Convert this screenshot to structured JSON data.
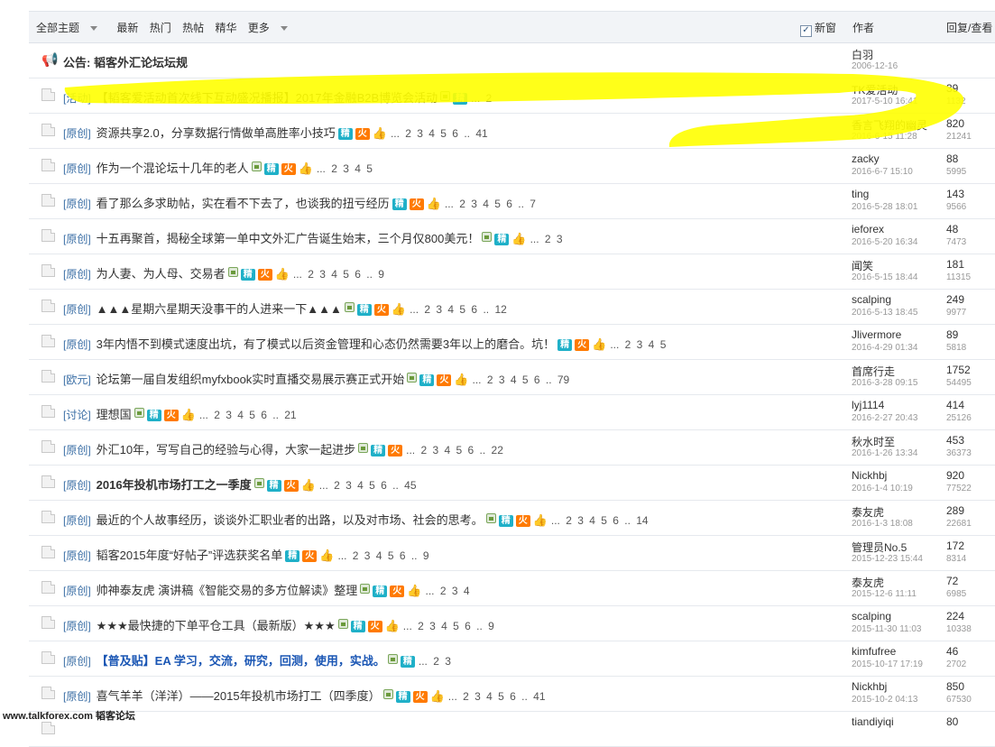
{
  "header": {
    "filters": [
      "全部主题",
      "最新",
      "热门",
      "热帖",
      "精华",
      "更多"
    ],
    "new_window_label": "新窗",
    "author_col": "作者",
    "reply_col": "回复/查看"
  },
  "announcement": {
    "label": "公告:",
    "title": "韬客外汇论坛坛规",
    "author": "白羽",
    "date": "2006-12-16"
  },
  "badges": {
    "jing": "精",
    "huo": "火",
    "thumb": "👍"
  },
  "threads": [
    {
      "cat": "[活动]",
      "title": "【韬客爱活动首次线下互动盛况播报】2017年金融B2B博览会活动",
      "img": true,
      "jing": true,
      "huo": false,
      "thumb": false,
      "pages": "... 2",
      "author": "TK爱活动",
      "date": "2017-5-10 16:41",
      "replies": "39",
      "views": "1132",
      "style": ""
    },
    {
      "cat": "[原创]",
      "title": "资源共享2.0，分享数据行情做单高胜率小技巧",
      "img": false,
      "jing": true,
      "huo": true,
      "thumb": true,
      "pages": "... 2 3 4 5 6 .. 41",
      "author": "香言飞翔的幽灵",
      "date": "2016-6-15 11:28",
      "replies": "820",
      "views": "21241",
      "style": ""
    },
    {
      "cat": "[原创]",
      "title": "作为一个混论坛十几年的老人",
      "img": true,
      "jing": true,
      "huo": true,
      "thumb": true,
      "pages": "... 2 3 4 5",
      "author": "zacky",
      "date": "2016-6-7 15:10",
      "replies": "88",
      "views": "5995",
      "style": ""
    },
    {
      "cat": "[原创]",
      "title": "看了那么多求助帖，实在看不下去了，也谈我的扭亏经历",
      "img": false,
      "jing": true,
      "huo": true,
      "thumb": true,
      "pages": "... 2 3 4 5 6 .. 7",
      "author": "ting",
      "date": "2016-5-28 18:01",
      "replies": "143",
      "views": "9566",
      "style": ""
    },
    {
      "cat": "[原创]",
      "title": "十五再聚首，揭秘全球第一单中文外汇广告诞生始末，三个月仅800美元！",
      "img": true,
      "jing": true,
      "huo": false,
      "thumb": true,
      "pages": "... 2 3",
      "author": "ieforex",
      "date": "2016-5-20 16:34",
      "replies": "48",
      "views": "7473",
      "style": ""
    },
    {
      "cat": "[原创]",
      "title": "为人妻、为人母、交易者",
      "img": true,
      "jing": true,
      "huo": true,
      "thumb": true,
      "pages": "... 2 3 4 5 6 .. 9",
      "author": "闻笑",
      "date": "2016-5-15 18:44",
      "replies": "181",
      "views": "11315",
      "style": ""
    },
    {
      "cat": "[原创]",
      "title": "▲▲▲星期六星期天没事干的人进来一下▲▲▲",
      "img": true,
      "jing": true,
      "huo": true,
      "thumb": true,
      "pages": "... 2 3 4 5 6 .. 12",
      "author": "scalping",
      "date": "2016-5-13 18:45",
      "replies": "249",
      "views": "9977",
      "style": ""
    },
    {
      "cat": "[原创]",
      "title": "3年内悟不到模式速度出坑，有了模式以后资金管理和心态仍然需要3年以上的磨合。坑！",
      "img": false,
      "jing": true,
      "huo": true,
      "thumb": true,
      "pages": "... 2 3 4 5",
      "author": "Jlivermore",
      "date": "2016-4-29 01:34",
      "replies": "89",
      "views": "5818",
      "style": ""
    },
    {
      "cat": "[欧元]",
      "title": "论坛第一届自发组织myfxbook实时直播交易展示赛正式开始",
      "img": true,
      "jing": true,
      "huo": true,
      "thumb": true,
      "pages": "... 2 3 4 5 6 .. 79",
      "author": "首席行走",
      "date": "2016-3-28 09:15",
      "replies": "1752",
      "views": "54495",
      "style": ""
    },
    {
      "cat": "[讨论]",
      "title": "理想国",
      "img": true,
      "jing": true,
      "huo": true,
      "thumb": true,
      "pages": "... 2 3 4 5 6 .. 21",
      "author": "lyj1114",
      "date": "2016-2-27 20:43",
      "replies": "414",
      "views": "25126",
      "style": ""
    },
    {
      "cat": "[原创]",
      "title": "外汇10年，写写自己的经验与心得，大家一起进步",
      "img": true,
      "jing": true,
      "huo": true,
      "thumb": false,
      "pages": "... 2 3 4 5 6 .. 22",
      "author": "秋水时至",
      "date": "2016-1-26 13:34",
      "replies": "453",
      "views": "36373",
      "style": ""
    },
    {
      "cat": "[原创]",
      "title": "2016年投机市场打工之一季度",
      "img": true,
      "jing": true,
      "huo": true,
      "thumb": true,
      "pages": "... 2 3 4 5 6 .. 45",
      "author": "Nickhbj",
      "date": "2016-1-4 10:19",
      "replies": "920",
      "views": "77522",
      "style": "bold"
    },
    {
      "cat": "[原创]",
      "title": "最近的个人故事经历，谈谈外汇职业者的出路，以及对市场、社会的思考。",
      "img": true,
      "jing": true,
      "huo": true,
      "thumb": true,
      "pages": "... 2 3 4 5 6 .. 14",
      "author": "泰友虎",
      "date": "2016-1-3 18:08",
      "replies": "289",
      "views": "22681",
      "style": ""
    },
    {
      "cat": "[原创]",
      "title": "韬客2015年度“好帖子”评选获奖名单",
      "img": false,
      "jing": true,
      "huo": true,
      "thumb": true,
      "pages": "... 2 3 4 5 6 .. 9",
      "author": "管理员No.5",
      "date": "2015-12-23 15:44",
      "replies": "172",
      "views": "8314",
      "style": ""
    },
    {
      "cat": "[原创]",
      "title": "帅神泰友虎 演讲稿《智能交易的多方位解读》整理",
      "img": true,
      "jing": true,
      "huo": true,
      "thumb": true,
      "pages": "... 2 3 4",
      "author": "泰友虎",
      "date": "2015-12-6 11:11",
      "replies": "72",
      "views": "6985",
      "style": ""
    },
    {
      "cat": "[原创]",
      "title": "★★★最快捷的下单平仓工具（最新版）★★★",
      "img": true,
      "jing": true,
      "huo": true,
      "thumb": true,
      "pages": "... 2 3 4 5 6 .. 9",
      "author": "scalping",
      "date": "2015-11-30 11:03",
      "replies": "224",
      "views": "10338",
      "style": ""
    },
    {
      "cat": "[原创]",
      "title": "【普及贴】EA 学习，交流，研究，回测，使用，实战。",
      "img": true,
      "jing": true,
      "huo": false,
      "thumb": false,
      "pages": "... 2 3",
      "author": "kimfufree",
      "date": "2015-10-17 17:19",
      "replies": "46",
      "views": "2702",
      "style": "blue"
    },
    {
      "cat": "[原创]",
      "title": "喜气羊羊（洋洋）——2015年投机市场打工（四季度）",
      "img": true,
      "jing": true,
      "huo": true,
      "thumb": true,
      "pages": "... 2 3 4 5 6 .. 41",
      "author": "Nickhbj",
      "date": "2015-10-2 04:13",
      "replies": "850",
      "views": "67530",
      "style": ""
    },
    {
      "cat": "",
      "title": "",
      "img": false,
      "jing": false,
      "huo": false,
      "thumb": false,
      "pages": "",
      "author": "tiandiyiqi",
      "date": "",
      "replies": "80",
      "views": "",
      "style": ""
    }
  ],
  "highlight_color": "#ffff00",
  "watermark": "www.talkforex.com 韬客论坛"
}
